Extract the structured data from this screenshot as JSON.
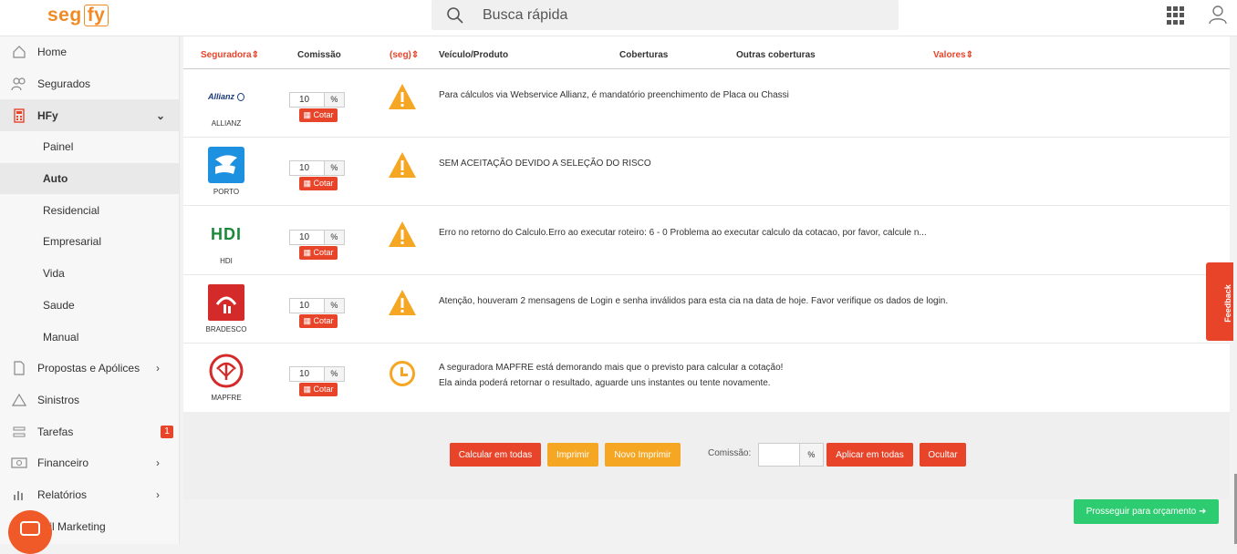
{
  "app": {
    "logo_left": "seg",
    "logo_right": "fy",
    "brand_color": "#f08a24"
  },
  "search": {
    "placeholder": "Busca rápida"
  },
  "sidebar": {
    "items": [
      {
        "label": "Home",
        "icon": "home-icon"
      },
      {
        "label": "Segurados",
        "icon": "users-icon"
      },
      {
        "label": "HFy",
        "icon": "calculator-icon",
        "expanded": true
      },
      {
        "label": "Painel"
      },
      {
        "label": "Auto",
        "selected": true
      },
      {
        "label": "Residencial"
      },
      {
        "label": "Empresarial"
      },
      {
        "label": "Vida"
      },
      {
        "label": "Saude"
      },
      {
        "label": "Manual"
      },
      {
        "label": "Propostas e Apólices",
        "icon": "document-icon"
      },
      {
        "label": "Sinistros",
        "icon": "warning-icon"
      },
      {
        "label": "Tarefas",
        "icon": "tasks-icon",
        "badge": "1"
      },
      {
        "label": "Financeiro",
        "icon": "money-icon"
      },
      {
        "label": "Relatórios",
        "icon": "chart-icon"
      },
      {
        "label": "nail Marketing",
        "icon": "chat-icon"
      }
    ]
  },
  "table": {
    "headers": {
      "seguradora": "Seguradora",
      "comissao": "Comissão",
      "seg": "(seg)",
      "veiculo": "Veículo/Produto",
      "coberturas": "Coberturas",
      "outras": "Outras coberturas",
      "valores": "Valores"
    },
    "rows": [
      {
        "insurer": "ALLIANZ",
        "logo_text": "Allianz",
        "commission": "10",
        "pct": "%",
        "button": "Cotar",
        "status": "warning",
        "message": [
          "Para cálculos via Webservice Allianz, é mandatório preenchimento de Placa ou Chassi"
        ]
      },
      {
        "insurer": "PORTO",
        "commission": "10",
        "pct": "%",
        "button": "Cotar",
        "status": "warning",
        "message": [
          "SEM ACEITAÇÃO DEVIDO A SELEÇÃO DO RISCO"
        ]
      },
      {
        "insurer": "HDI",
        "logo_text": "HDI",
        "commission": "10",
        "pct": "%",
        "button": "Cotar",
        "status": "warning",
        "message": [
          "Erro no retorno do Calculo.Erro ao executar roteiro: 6 - 0 Problema ao executar calculo da cotacao, por favor, calcule n..."
        ]
      },
      {
        "insurer": "BRADESCO",
        "commission": "10",
        "pct": "%",
        "button": "Cotar",
        "status": "warning",
        "message": [
          "Atenção, houveram 2 mensagens de Login e senha inválidos para esta cia na data de hoje. Favor verifique os dados de login."
        ]
      },
      {
        "insurer": "MAPFRE",
        "commission": "10",
        "pct": "%",
        "button": "Cotar",
        "status": "pending",
        "message": [
          "A seguradora MAPFRE está demorando mais que o previsto para calcular a cotação!",
          "Ela ainda poderá retornar o resultado, aguarde uns instantes ou tente novamente."
        ]
      }
    ]
  },
  "actions": {
    "calc_all": "Calcular em todas",
    "print": "Imprimir",
    "new_print": "Novo Imprimir",
    "commission_label": "Comissão:",
    "commission_value": "",
    "pct": "%",
    "apply_all": "Aplicar em todas",
    "hide": "Ocultar",
    "proceed": "Prosseguir para orçamento"
  },
  "feedback": {
    "label": "Feedback"
  },
  "colors": {
    "accent_red": "#e8442a",
    "warning_orange": "#f5a623",
    "success_green": "#2ecc71"
  }
}
